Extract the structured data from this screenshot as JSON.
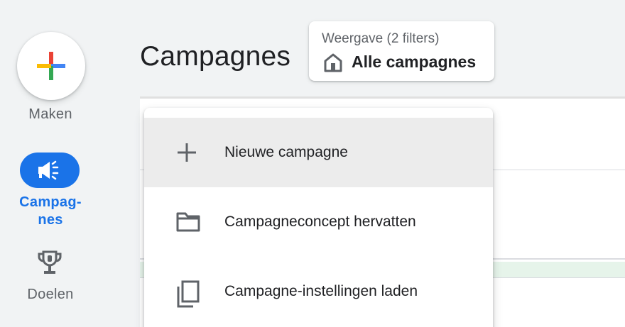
{
  "sidebar": {
    "create": {
      "label": "Maken",
      "icon": "multicolor-plus-icon"
    },
    "items": [
      {
        "label": "Campag-\nnes",
        "icon": "megaphone-icon",
        "active": true
      },
      {
        "label": "Doelen",
        "icon": "trophy-icon",
        "active": false
      }
    ]
  },
  "header": {
    "title": "Campagnes",
    "view_selector": {
      "caption": "Weergave (2 filters)",
      "value": "Alle campagnes",
      "icon": "home-icon"
    }
  },
  "menu": {
    "items": [
      {
        "label": "Nieuwe campagne",
        "icon": "plus-icon",
        "highlighted": true
      },
      {
        "label": "Campagneconcept hervatten",
        "icon": "folder-icon",
        "highlighted": false
      },
      {
        "label": "Campagne-instellingen laden",
        "icon": "copy-icon",
        "highlighted": false
      }
    ]
  },
  "colors": {
    "accent": "#1a73e8",
    "plus_red": "#ea4335",
    "plus_blue": "#4285f4",
    "plus_yellow": "#fbbc04",
    "plus_green": "#34a853"
  }
}
